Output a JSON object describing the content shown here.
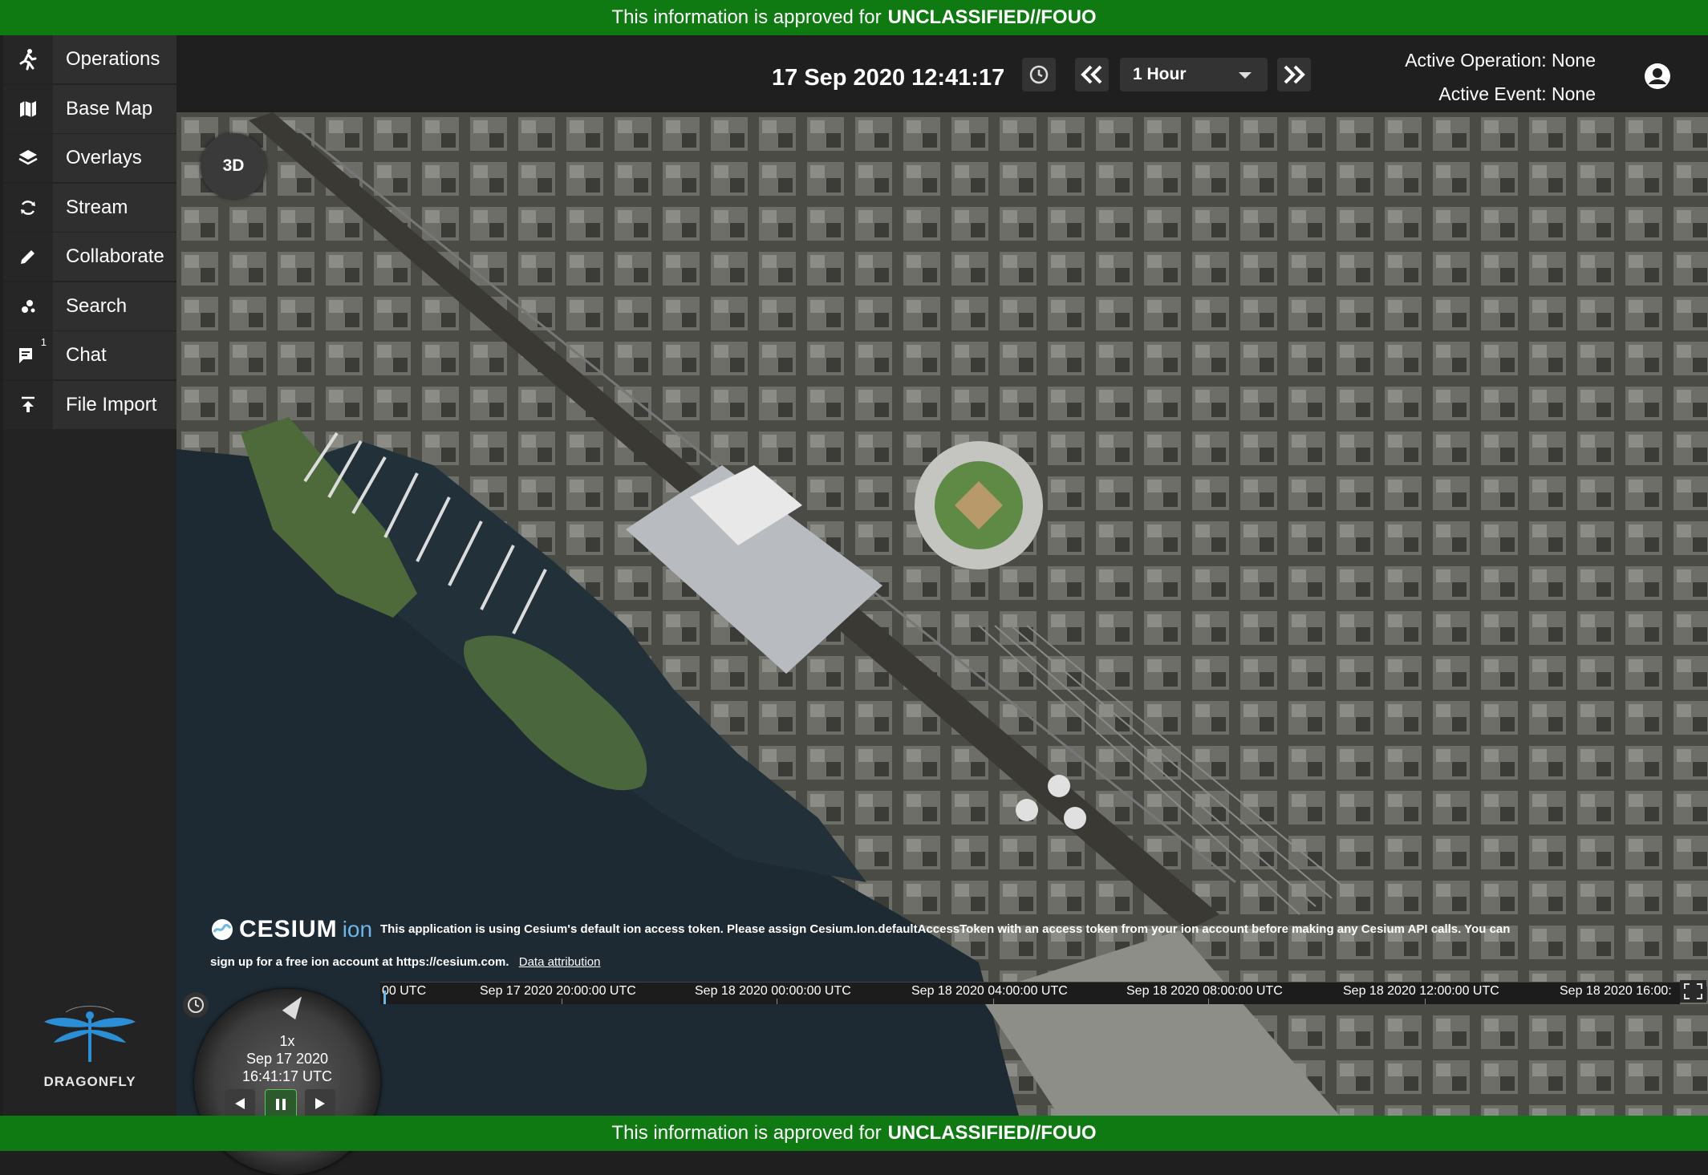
{
  "classification": {
    "prefix": "This information is approved for",
    "level": "UNCLASSIFIED//FOUO"
  },
  "sidebar": {
    "items": [
      {
        "label": "Operations",
        "icon": "running-person-icon",
        "badge": ""
      },
      {
        "label": "Base Map",
        "icon": "map-icon",
        "badge": ""
      },
      {
        "label": "Overlays",
        "icon": "layers-icon",
        "badge": ""
      },
      {
        "label": "Stream",
        "icon": "sync-icon",
        "badge": ""
      },
      {
        "label": "Collaborate",
        "icon": "pencil-icon",
        "badge": ""
      },
      {
        "label": "Search",
        "icon": "dots-icon",
        "badge": ""
      },
      {
        "label": "Chat",
        "icon": "chat-icon",
        "badge": "1"
      },
      {
        "label": "File Import",
        "icon": "upload-icon",
        "badge": ""
      }
    ],
    "logo_text": "DRAGONFLY"
  },
  "topbar": {
    "datetime": "17 Sep 2020 12:41:17",
    "range": "1 Hour",
    "active_operation": "Active Operation: None",
    "active_event": "Active Event: None"
  },
  "map": {
    "mode_button": "3D",
    "credit": {
      "logo_text": "CESIUM",
      "logo_suffix": "ion",
      "line1": "This application is using Cesium's default ion access token. Please assign Cesium.Ion.defaultAccessToken with an access token from your ion account before making any Cesium API calls. You can",
      "line2": "sign up for a free ion account at https://cesium.com.",
      "link": "Data attribution"
    }
  },
  "animation": {
    "speed": "1x",
    "date": "Sep 17 2020",
    "time": "16:41:17 UTC"
  },
  "timeline": {
    "labels": [
      "00 UTC",
      "Sep 17 2020 20:00:00 UTC",
      "Sep 18 2020 00:00:00 UTC",
      "Sep 18 2020 04:00:00 UTC",
      "Sep 18 2020 08:00:00 UTC",
      "Sep 18 2020 12:00:00 UTC",
      "Sep 18 2020 16:00:"
    ]
  },
  "colors": {
    "banner": "#0f7a12",
    "water": "#1c2630",
    "land": "#3a3c35"
  }
}
